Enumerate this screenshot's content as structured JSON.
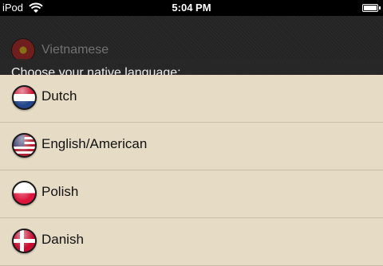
{
  "status_bar": {
    "carrier": "iPod",
    "time": "5:04 PM",
    "wifi_icon": "wifi-icon",
    "battery_icon": "battery-icon"
  },
  "header": {
    "behind_item": "Vietnamese",
    "prompt": "Choose your native language:"
  },
  "languages": [
    {
      "label": "Dutch",
      "flag": "netherlands-flag-icon"
    },
    {
      "label": "English/American",
      "flag": "usa-flag-icon"
    },
    {
      "label": "Polish",
      "flag": "poland-flag-icon"
    },
    {
      "label": "Danish",
      "flag": "denmark-flag-icon"
    }
  ],
  "colors": {
    "list_background": "#e6dcc6",
    "header_background": "#262626",
    "separator": "#c9bea8"
  }
}
